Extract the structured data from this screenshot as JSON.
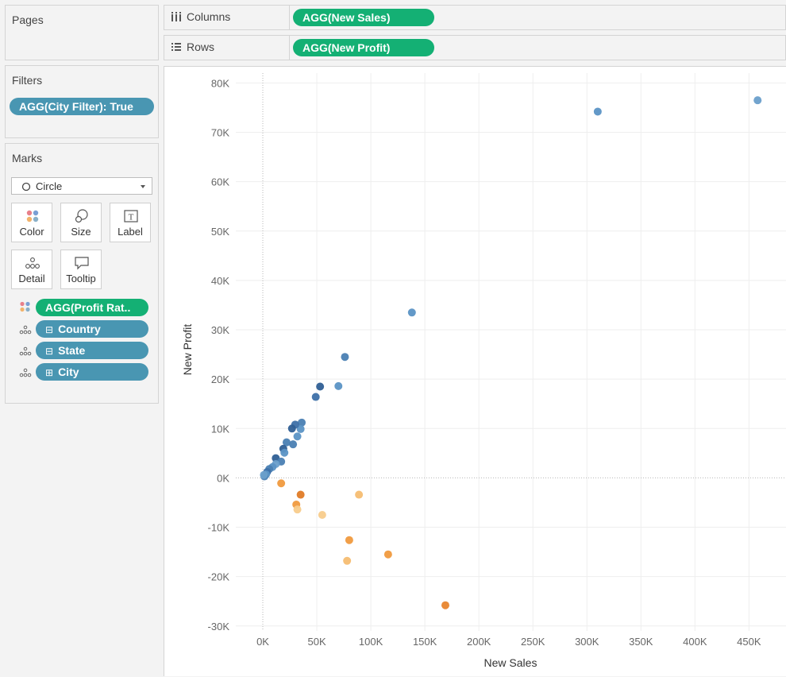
{
  "pages": {
    "title": "Pages"
  },
  "columns": {
    "label": "Columns",
    "pill": "AGG(New Sales)"
  },
  "rows": {
    "label": "Rows",
    "pill": "AGG(New Profit)"
  },
  "filters": {
    "title": "Filters",
    "pill": "AGG(City Filter): True"
  },
  "marks": {
    "title": "Marks",
    "mark_type": "Circle",
    "buttons": {
      "color": "Color",
      "size": "Size",
      "label": "Label",
      "detail": "Detail",
      "tooltip": "Tooltip"
    },
    "fields": [
      {
        "label": "AGG(Profit Rat..",
        "icon": "color-icon",
        "color": "#14b074"
      },
      {
        "label": "Country",
        "icon": "detail-icon",
        "prefix": "⊟",
        "color": "#4996b2"
      },
      {
        "label": "State",
        "icon": "detail-icon",
        "prefix": "⊟",
        "color": "#4996b2"
      },
      {
        "label": "City",
        "icon": "detail-icon",
        "prefix": "⊞",
        "color": "#4996b2"
      }
    ]
  },
  "chart_data": {
    "type": "scatter",
    "xlabel": "New Sales",
    "ylabel": "New Profit",
    "xlim": [
      -25000,
      485000
    ],
    "ylim": [
      -31000,
      82000
    ],
    "xticks": [
      0,
      50000,
      100000,
      150000,
      200000,
      250000,
      300000,
      350000,
      400000,
      450000
    ],
    "xtick_labels": [
      "0K",
      "50K",
      "100K",
      "150K",
      "200K",
      "250K",
      "300K",
      "350K",
      "400K",
      "450K"
    ],
    "yticks": [
      -30000,
      -20000,
      -10000,
      0,
      10000,
      20000,
      30000,
      40000,
      50000,
      60000,
      70000,
      80000
    ],
    "ytick_labels": [
      "-30K",
      "-20K",
      "-10K",
      "0K",
      "10K",
      "20K",
      "30K",
      "40K",
      "50K",
      "60K",
      "70K",
      "80K"
    ],
    "grid": true,
    "points": [
      {
        "x": 458000,
        "y": 76500,
        "color": "#6a9fcb"
      },
      {
        "x": 310000,
        "y": 74200,
        "color": "#5b93c5"
      },
      {
        "x": 138000,
        "y": 33500,
        "color": "#5b93c5"
      },
      {
        "x": 76000,
        "y": 24500,
        "color": "#4a7fb3"
      },
      {
        "x": 70000,
        "y": 18600,
        "color": "#5b93c5"
      },
      {
        "x": 53000,
        "y": 18500,
        "color": "#2f5f95"
      },
      {
        "x": 49000,
        "y": 16400,
        "color": "#3d70a8"
      },
      {
        "x": 36000,
        "y": 11200,
        "color": "#4a7fb3"
      },
      {
        "x": 35000,
        "y": 9900,
        "color": "#5b93c5"
      },
      {
        "x": 30000,
        "y": 10800,
        "color": "#3d70a8"
      },
      {
        "x": 27000,
        "y": 10000,
        "color": "#2f5f95"
      },
      {
        "x": 32000,
        "y": 8400,
        "color": "#5b93c5"
      },
      {
        "x": 22000,
        "y": 7200,
        "color": "#4a7fb3"
      },
      {
        "x": 28000,
        "y": 6800,
        "color": "#4a7fb3"
      },
      {
        "x": 19000,
        "y": 5900,
        "color": "#2f5f95"
      },
      {
        "x": 20000,
        "y": 5100,
        "color": "#5b93c5"
      },
      {
        "x": 12000,
        "y": 4000,
        "color": "#2f5f95"
      },
      {
        "x": 17000,
        "y": 3300,
        "color": "#4a7fb3"
      },
      {
        "x": 12000,
        "y": 2800,
        "color": "#6a9fcb"
      },
      {
        "x": 9000,
        "y": 2200,
        "color": "#5b93c5"
      },
      {
        "x": 6000,
        "y": 1800,
        "color": "#4a7fb3"
      },
      {
        "x": 4000,
        "y": 1200,
        "color": "#3d70a8"
      },
      {
        "x": 3000,
        "y": 700,
        "color": "#5b93c5"
      },
      {
        "x": 1500,
        "y": 300,
        "color": "#4a7fb3"
      },
      {
        "x": 1000,
        "y": 600,
        "color": "#6a9fcb"
      },
      {
        "x": 17000,
        "y": -1100,
        "color": "#f09a3e"
      },
      {
        "x": 35000,
        "y": -3400,
        "color": "#e07b26"
      },
      {
        "x": 89000,
        "y": -3400,
        "color": "#f6bd72"
      },
      {
        "x": 31000,
        "y": -5400,
        "color": "#f09a3e"
      },
      {
        "x": 32000,
        "y": -6400,
        "color": "#f8cc8c"
      },
      {
        "x": 55000,
        "y": -7500,
        "color": "#f8cc8c"
      },
      {
        "x": 80000,
        "y": -12600,
        "color": "#f09a3e"
      },
      {
        "x": 116000,
        "y": -15500,
        "color": "#f09a3e"
      },
      {
        "x": 78000,
        "y": -16800,
        "color": "#f6bd72"
      },
      {
        "x": 169000,
        "y": -25800,
        "color": "#e8852e"
      }
    ]
  }
}
